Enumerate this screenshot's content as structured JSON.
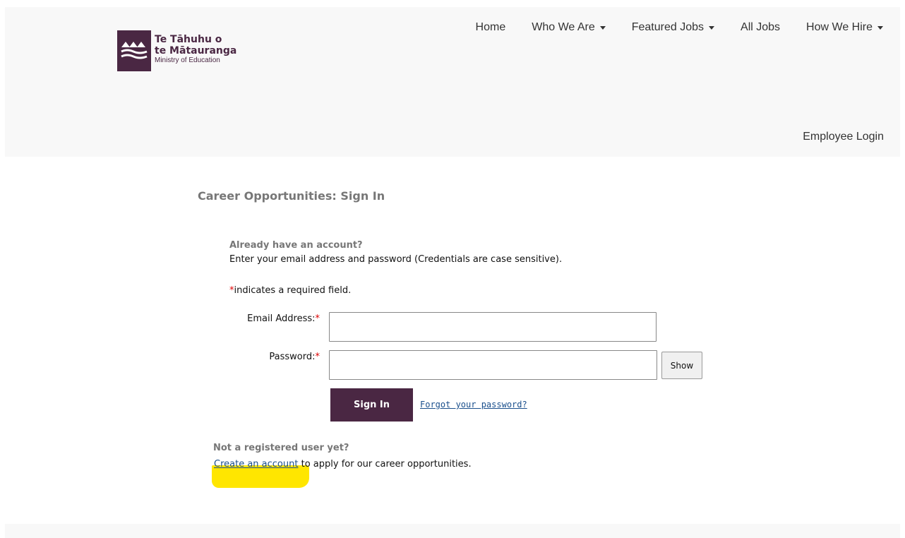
{
  "brand": {
    "line1": "Te Tāhuhu o",
    "line2": "te Mātauranga",
    "line3": "Ministry of Education",
    "color": "#4a2743"
  },
  "nav": {
    "items": [
      {
        "label": "Home",
        "dropdown": false
      },
      {
        "label": "Who We Are",
        "dropdown": true
      },
      {
        "label": "Featured Jobs",
        "dropdown": true
      },
      {
        "label": "All Jobs",
        "dropdown": false
      },
      {
        "label": "How We Hire",
        "dropdown": true
      }
    ],
    "employee_login": "Employee Login"
  },
  "page": {
    "title": "Career Opportunities: Sign In"
  },
  "signin": {
    "already_heading": "Already have an account?",
    "instructions": "Enter your email address and password (Credentials are case sensitive).",
    "required_marker": "*",
    "required_note": "indicates a required field.",
    "email_label": "Email Address:",
    "email_value": "",
    "password_label": "Password:",
    "password_value": "",
    "show_label": "Show",
    "signin_label": "Sign In",
    "forgot_label": "Forgot your password?"
  },
  "register": {
    "heading": "Not a registered user yet?",
    "create_link": "Create an account",
    "create_suffix": " to apply for our career opportunities.",
    "highlight_color": "#ffe600"
  },
  "colors": {
    "link": "#1a4f8c",
    "required": "#dd0000",
    "header_bg": "#f8f8f8"
  }
}
